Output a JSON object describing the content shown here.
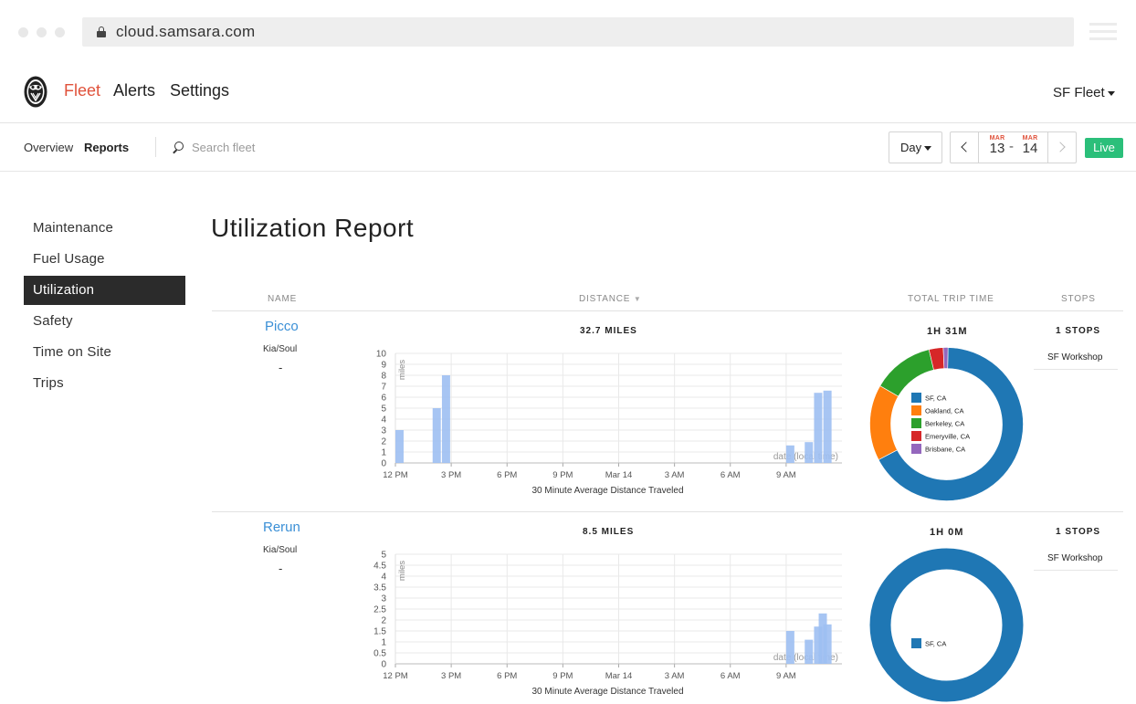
{
  "browser": {
    "url": "cloud.samsara.com"
  },
  "nav": {
    "items": [
      {
        "label": "Fleet",
        "active": true
      },
      {
        "label": "Alerts",
        "active": false
      },
      {
        "label": "Settings",
        "active": false
      }
    ],
    "fleet_selector": "SF Fleet"
  },
  "subnav": {
    "overview": "Overview",
    "reports": "Reports",
    "search_placeholder": "Search fleet",
    "range_mode": "Day",
    "start": {
      "month": "MAR",
      "day": "13"
    },
    "end": {
      "month": "MAR",
      "day": "14"
    },
    "separator": "-",
    "live": "Live"
  },
  "sidebar": {
    "items": [
      "Maintenance",
      "Fuel Usage",
      "Utilization",
      "Safety",
      "Time on Site",
      "Trips"
    ],
    "active": "Utilization"
  },
  "report": {
    "title": "Utilization Report",
    "columns": {
      "name": "NAME",
      "distance": "DISTANCE",
      "trip_time": "TOTAL TRIP TIME",
      "stops": "STOPS"
    },
    "colors": {
      "bar": "#9dbff2",
      "sf": "#1f77b4",
      "oakland": "#ff7f0e",
      "berkeley": "#2ca02c",
      "emeryville": "#d62728",
      "brisbane": "#9467bd",
      "link": "#3a8fd6"
    }
  },
  "vehicles": [
    {
      "name": "Picco",
      "model": "Kia/Soul",
      "dash": "-",
      "distance": "32.7 MILES",
      "trip_time": "1H 31M",
      "stops": "1 STOPS",
      "stop_name": "SF Workshop"
    },
    {
      "name": "Rerun",
      "model": "Kia/Soul",
      "dash": "-",
      "distance": "8.5 MILES",
      "trip_time": "1H 0M",
      "stops": "1 STOPS",
      "stop_name": "SF Workshop"
    }
  ],
  "chart_data": [
    {
      "type": "bar",
      "xlabel": "30 Minute Average Distance Traveled",
      "ylabel": "miles",
      "x_annotation": "date (local time)",
      "ylim": [
        0,
        10
      ],
      "yticks": [
        "0",
        "1",
        "2",
        "3",
        "4",
        "5",
        "6",
        "7",
        "8",
        "9",
        "10"
      ],
      "xticks": [
        "12 PM",
        "3 PM",
        "6 PM",
        "9 PM",
        "Mar 14",
        "3 AM",
        "6 AM",
        "9 AM"
      ],
      "bars": [
        {
          "x": "12 PM",
          "value": 3
        },
        {
          "x": "2 PM",
          "value": 5
        },
        {
          "x": "2:30 PM",
          "value": 8
        },
        {
          "x": "9 AM",
          "value": 1.6
        },
        {
          "x": "10 AM",
          "value": 1.9
        },
        {
          "x": "10:30 AM",
          "value": 6.4
        },
        {
          "x": "11 AM",
          "value": 6.6
        }
      ]
    },
    {
      "type": "bar",
      "xlabel": "30 Minute Average Distance Traveled",
      "ylabel": "miles",
      "x_annotation": "date (local time)",
      "ylim": [
        0,
        5
      ],
      "yticks": [
        "0",
        "0.5",
        "1",
        "1.5",
        "2",
        "2.5",
        "3",
        "3.5",
        "4",
        "4.5",
        "5"
      ],
      "xticks": [
        "12 PM",
        "3 PM",
        "6 PM",
        "9 PM",
        "Mar 14",
        "3 AM",
        "6 AM",
        "9 AM"
      ],
      "bars": [
        {
          "x": "9 AM",
          "value": 1.5
        },
        {
          "x": "10 AM",
          "value": 1.1
        },
        {
          "x": "10:30 AM",
          "value": 1.7
        },
        {
          "x": "10:45 AM",
          "value": 2.3
        },
        {
          "x": "11 AM",
          "value": 1.8
        }
      ]
    },
    {
      "type": "pie",
      "labels": [
        "SF, CA",
        "Oakland, CA",
        "Berkeley, CA",
        "Emeryville, CA",
        "Brisbane, CA"
      ],
      "values": [
        67,
        16,
        13,
        3,
        1
      ]
    },
    {
      "type": "pie",
      "labels": [
        "SF, CA"
      ],
      "values": [
        100
      ]
    }
  ]
}
